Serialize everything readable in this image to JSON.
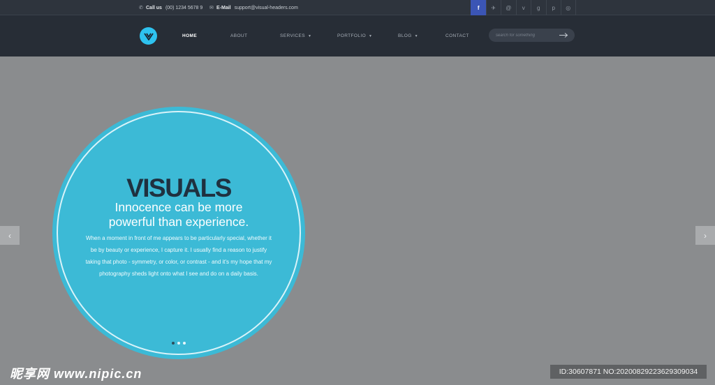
{
  "topbar": {
    "call_label": "Call us",
    "call_value": "(00) 1234 5678 9",
    "email_label": "E-Mail",
    "email_value": "support@visual-headers.com",
    "phone_icon": "phone-icon",
    "mail_icon": "mail-icon",
    "social": [
      {
        "icon": "facebook-icon",
        "glyph": "f"
      },
      {
        "icon": "twitter-icon",
        "glyph": "✈"
      },
      {
        "icon": "at-icon",
        "glyph": "@"
      },
      {
        "icon": "vimeo-icon",
        "glyph": "v"
      },
      {
        "icon": "google-plus-icon",
        "glyph": "g"
      },
      {
        "icon": "pinterest-icon",
        "glyph": "p"
      },
      {
        "icon": "instagram-icon",
        "glyph": "◎"
      }
    ]
  },
  "nav": {
    "logo_letter": "V",
    "items": [
      "HOME",
      "ABOUT",
      "SERVICES",
      "PORTFOLIO",
      "BLOG",
      "CONTACT"
    ],
    "search_placeholder": "search for something"
  },
  "hero": {
    "title": "VISUALS",
    "subtitle_line1": "Innocence can be more",
    "subtitle_line2": "powerful than experience.",
    "body": "When a moment in front of me appears to be particularly special, whether it be by beauty or experience, I capture it. I usually find a reason to justify taking that photo - symmetry, or color, or contrast - and it's my hope that my photography sheds light onto what I see and do on a daily basis.",
    "prev_glyph": "‹",
    "next_glyph": "›"
  },
  "watermark": {
    "site_cn": "昵享网",
    "site_url": "www.nipic.cn",
    "id_text": "ID:30607871 NO:20200829223629309034"
  },
  "colors": {
    "accent": "#3cbad6",
    "logo": "#2ec2ef",
    "facebook_active": "#3b55b5",
    "nav_bg": "#272d36"
  }
}
